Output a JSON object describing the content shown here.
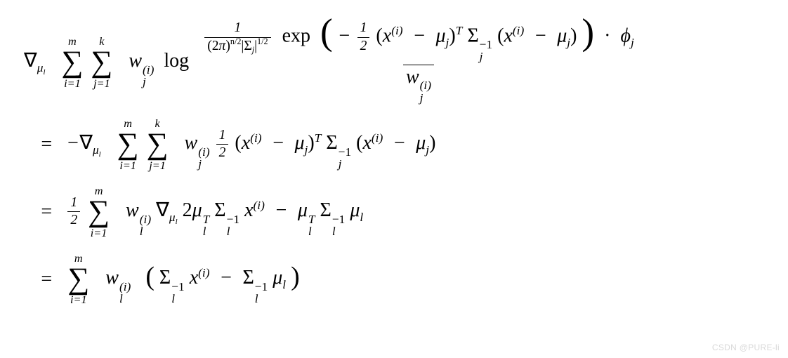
{
  "chart_data": {
    "type": "equation",
    "latex": "\\nabla_{\\mu_l} \\sum_{i=1}^{m} \\sum_{j=1}^{k} w_j^{(i)} \\log \\frac{ \\frac{1}{(2\\pi)^{n/2} |\\Sigma_j|^{1/2}} \\exp\\!\\left( -\\tfrac{1}{2} (x^{(i)} - \\mu_j)^T \\Sigma_j^{-1} (x^{(i)} - \\mu_j) \\right) \\cdot \\phi_j }{ w_j^{(i)} } \\\\ = -\\nabla_{\\mu_l} \\sum_{i=1}^{m} \\sum_{j=1}^{k} w_j^{(i)} \\tfrac{1}{2} (x^{(i)} - \\mu_j)^T \\Sigma_j^{-1} (x^{(i)} - \\mu_j) \\\\ = \\tfrac{1}{2} \\sum_{i=1}^{m} w_l^{(i)} \\nabla_{\\mu_l} \\, 2\\mu_l^T \\Sigma_l^{-1} x^{(i)} - \\mu_l^T \\Sigma_l^{-1} \\mu_l \\\\ = \\sum_{i=1}^{m} w_l^{(i)} \\left( \\Sigma_l^{-1} x^{(i)} - \\Sigma_l^{-1} \\mu_l \\right)"
  },
  "sym": {
    "nabla": "∇",
    "mu": "μ",
    "Sigma": "Σ",
    "pi": "π",
    "phi": "ϕ",
    "minus": "−",
    "cdot": "·",
    "eq": "=",
    "log": "log",
    "exp": "exp"
  },
  "sum": {
    "i_top": "m",
    "i_bot": "i=1",
    "j_top": "k",
    "j_bot": "j=1"
  },
  "txt": {
    "half_num": "1",
    "half_den": "2",
    "two": "2",
    "norm_num": "1",
    "norm_den_a": "(2",
    "norm_den_b": ")",
    "norm_den_exp1": "n/2",
    "norm_den_bar": "|",
    "norm_den_exp2": "1/2",
    "x": "x",
    "w": "w",
    "T": "T",
    "inv": "−1",
    "i": "(i)",
    "j": "j",
    "l": "l",
    "lparen": "(",
    "rparen": ")"
  },
  "watermark": "CSDN @PURE-li"
}
